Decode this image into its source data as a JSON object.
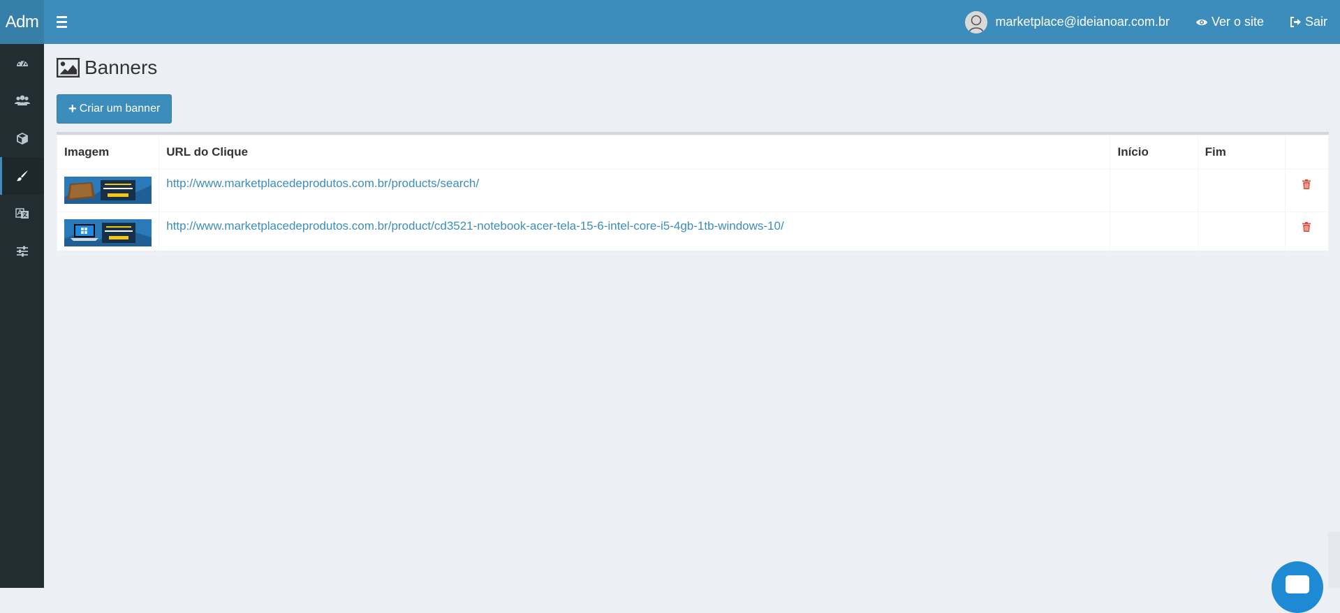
{
  "header": {
    "logo": "Adm",
    "user_email": "marketplace@ideianoar.com.br",
    "view_site_label": "Ver o site",
    "logout_label": "Sair",
    "colors": {
      "bar": "#3c8dbc",
      "logo_bg": "#367fa9"
    }
  },
  "sidebar": {
    "items": [
      {
        "icon": "dashboard-icon"
      },
      {
        "icon": "users-icon"
      },
      {
        "icon": "cube-icon"
      },
      {
        "icon": "paint-brush-icon",
        "active": true
      },
      {
        "icon": "language-icon"
      },
      {
        "icon": "sliders-icon"
      }
    ],
    "colors": {
      "bg": "#222d32",
      "active_accent": "#3c8dbc"
    }
  },
  "page": {
    "icon": "image-icon",
    "title": "Banners",
    "create_button_label": "Criar um banner"
  },
  "table": {
    "headers": [
      "Imagem",
      "URL do Clique",
      "Início",
      "Fim",
      ""
    ],
    "rows": [
      {
        "image": "banner-thumbnail",
        "url": "http://www.marketplacedeprodutos.com.br/products/search/",
        "start": "",
        "end": ""
      },
      {
        "image": "banner-thumbnail",
        "url": "http://www.marketplacedeprodutos.com.br/product/cd3521-notebook-acer-tela-15-6-intel-core-i5-4gb-1tb-windows-10/",
        "start": "",
        "end": ""
      }
    ]
  }
}
